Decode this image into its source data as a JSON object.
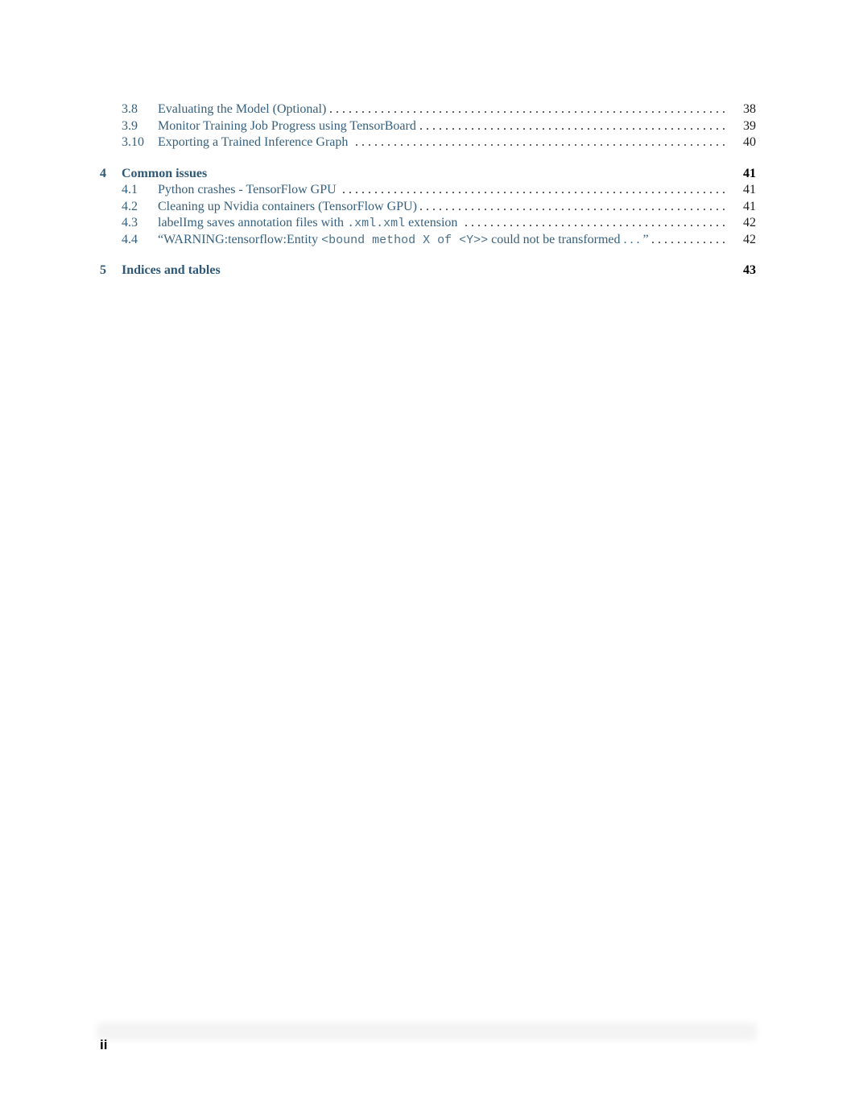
{
  "toc": {
    "section3_items": [
      {
        "num": "3.8",
        "title": "Evaluating the Model (Optional)",
        "page": "38"
      },
      {
        "num": "3.9",
        "title": "Monitor Training Job Progress using TensorBoard",
        "page": "39"
      },
      {
        "num": "3.10",
        "title": "Exporting a Trained Inference Graph",
        "page": "40"
      }
    ],
    "chapter4": {
      "num": "4",
      "title": "Common issues",
      "page": "41",
      "items": [
        {
          "num": "4.1",
          "title": "Python crashes - TensorFlow GPU",
          "page": "41"
        },
        {
          "num": "4.2",
          "title": "Cleaning up Nvidia containers (TensorFlow GPU)",
          "page": "41"
        },
        {
          "num": "4.3",
          "title_pre": "labelImg saves annotation files with ",
          "title_code": ".xml.xml",
          "title_post": " extension",
          "page": "42"
        },
        {
          "num": "4.4",
          "title_pre": "“WARNING:tensorflow:Entity ",
          "title_code": "<bound method X of <Y>>",
          "title_post": " could not be transformed . . . ”",
          "page": "42"
        }
      ]
    },
    "chapter5": {
      "num": "5",
      "title": "Indices and tables",
      "page": "43"
    }
  },
  "footer": {
    "page_label": "ii"
  }
}
